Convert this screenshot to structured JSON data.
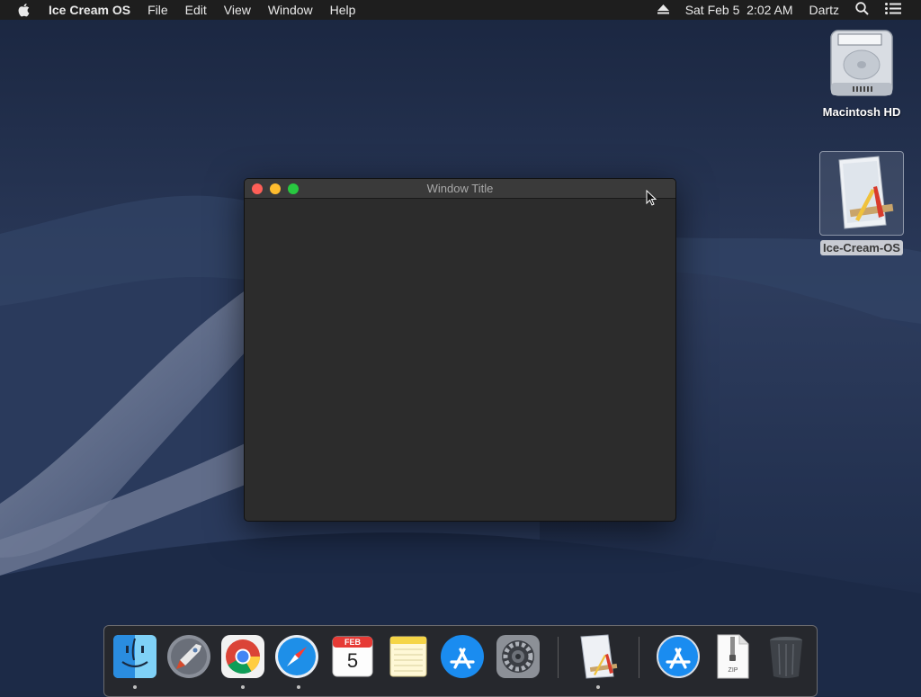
{
  "menubar": {
    "app_name": "Ice Cream OS",
    "menus": [
      "File",
      "Edit",
      "View",
      "Window",
      "Help"
    ],
    "clock": "Sat Feb 5  2:02 AM",
    "user": "Dartz",
    "icons": [
      "apple-icon",
      "eject-icon",
      "search-icon",
      "menu-list-icon"
    ]
  },
  "desktop": {
    "icons": [
      {
        "label": "Macintosh HD",
        "icon": "hard-drive-icon"
      },
      {
        "label": "Ice-Cream-OS",
        "icon": "app-document-icon",
        "selected": true
      }
    ]
  },
  "window": {
    "title": "Window Title",
    "buttons": [
      "close",
      "minimize",
      "maximize"
    ]
  },
  "dock": {
    "items": [
      {
        "name": "Finder",
        "icon": "finder-icon",
        "running": true
      },
      {
        "name": "Launchpad",
        "icon": "launchpad-icon",
        "running": false
      },
      {
        "name": "Chrome",
        "icon": "chrome-icon",
        "running": true
      },
      {
        "name": "Safari",
        "icon": "safari-icon",
        "running": true
      },
      {
        "name": "Calendar",
        "icon": "calendar-icon",
        "running": false
      },
      {
        "name": "Notes",
        "icon": "notes-icon",
        "running": false
      },
      {
        "name": "App Store",
        "icon": "app-store-icon",
        "running": false
      },
      {
        "name": "System Preferences",
        "icon": "gear-icon",
        "running": false
      },
      {
        "name": "Ice-Cream-OS",
        "icon": "app-document-icon",
        "running": true
      },
      {
        "name": "Downloads App Store",
        "icon": "app-store-icon",
        "running": false
      },
      {
        "name": "Archive",
        "icon": "zip-file-icon",
        "running": false
      },
      {
        "name": "Trash",
        "icon": "trash-icon",
        "running": false
      }
    ],
    "calendar": {
      "month": "FEB",
      "day": "5"
    },
    "zip_label": "ZIP"
  },
  "colors": {
    "menubar": "#1e1e1e",
    "window_bg": "#2c2c2c",
    "close": "#ff5f57",
    "minimize": "#febc2e",
    "maximize": "#28c840"
  }
}
